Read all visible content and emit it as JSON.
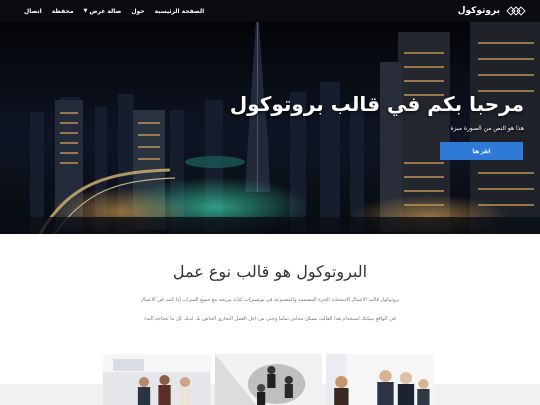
{
  "navbar": {
    "brand_name": "بروتوكول",
    "logo_icon": "interlocking-rings-logo",
    "menu": [
      {
        "label": "الصفحة الرئيسية",
        "has_dropdown": false
      },
      {
        "label": "حول",
        "has_dropdown": false
      },
      {
        "label": "صالة عرض",
        "has_dropdown": true
      },
      {
        "label": "محفظة",
        "has_dropdown": false
      },
      {
        "label": "اتصال",
        "has_dropdown": false
      }
    ]
  },
  "hero": {
    "title": "مرحبا بكم في قالب بروتوكول",
    "subtitle": "هذا هو النص من الصورة ميزة",
    "button_label": "انقر هنا"
  },
  "content": {
    "title": "البروتوكول هو قالب نوع عمل",
    "line1": "بروتوكول قالب الأعمال الاستجابة الحرة المصممة والمصنوعة في بوتستراب كتابة مريحة مع جميع الميزات إذا كنت في الأعمال",
    "line2": "في الواقع يمكنك استخدام هذا القالب بشكل مجاني تماما وحتى من أجل العمل التجاري الخاص بك لديك كل ما تحتاجه البدء"
  },
  "gallery": [
    {
      "name": "office-team-photo"
    },
    {
      "name": "business-meeting-photo"
    },
    {
      "name": "colleagues-photo"
    }
  ],
  "colors": {
    "navbar_bg": "#0b0c10",
    "accent": "#2f7ad6",
    "title_text": "#333333",
    "body_text": "#777777"
  }
}
